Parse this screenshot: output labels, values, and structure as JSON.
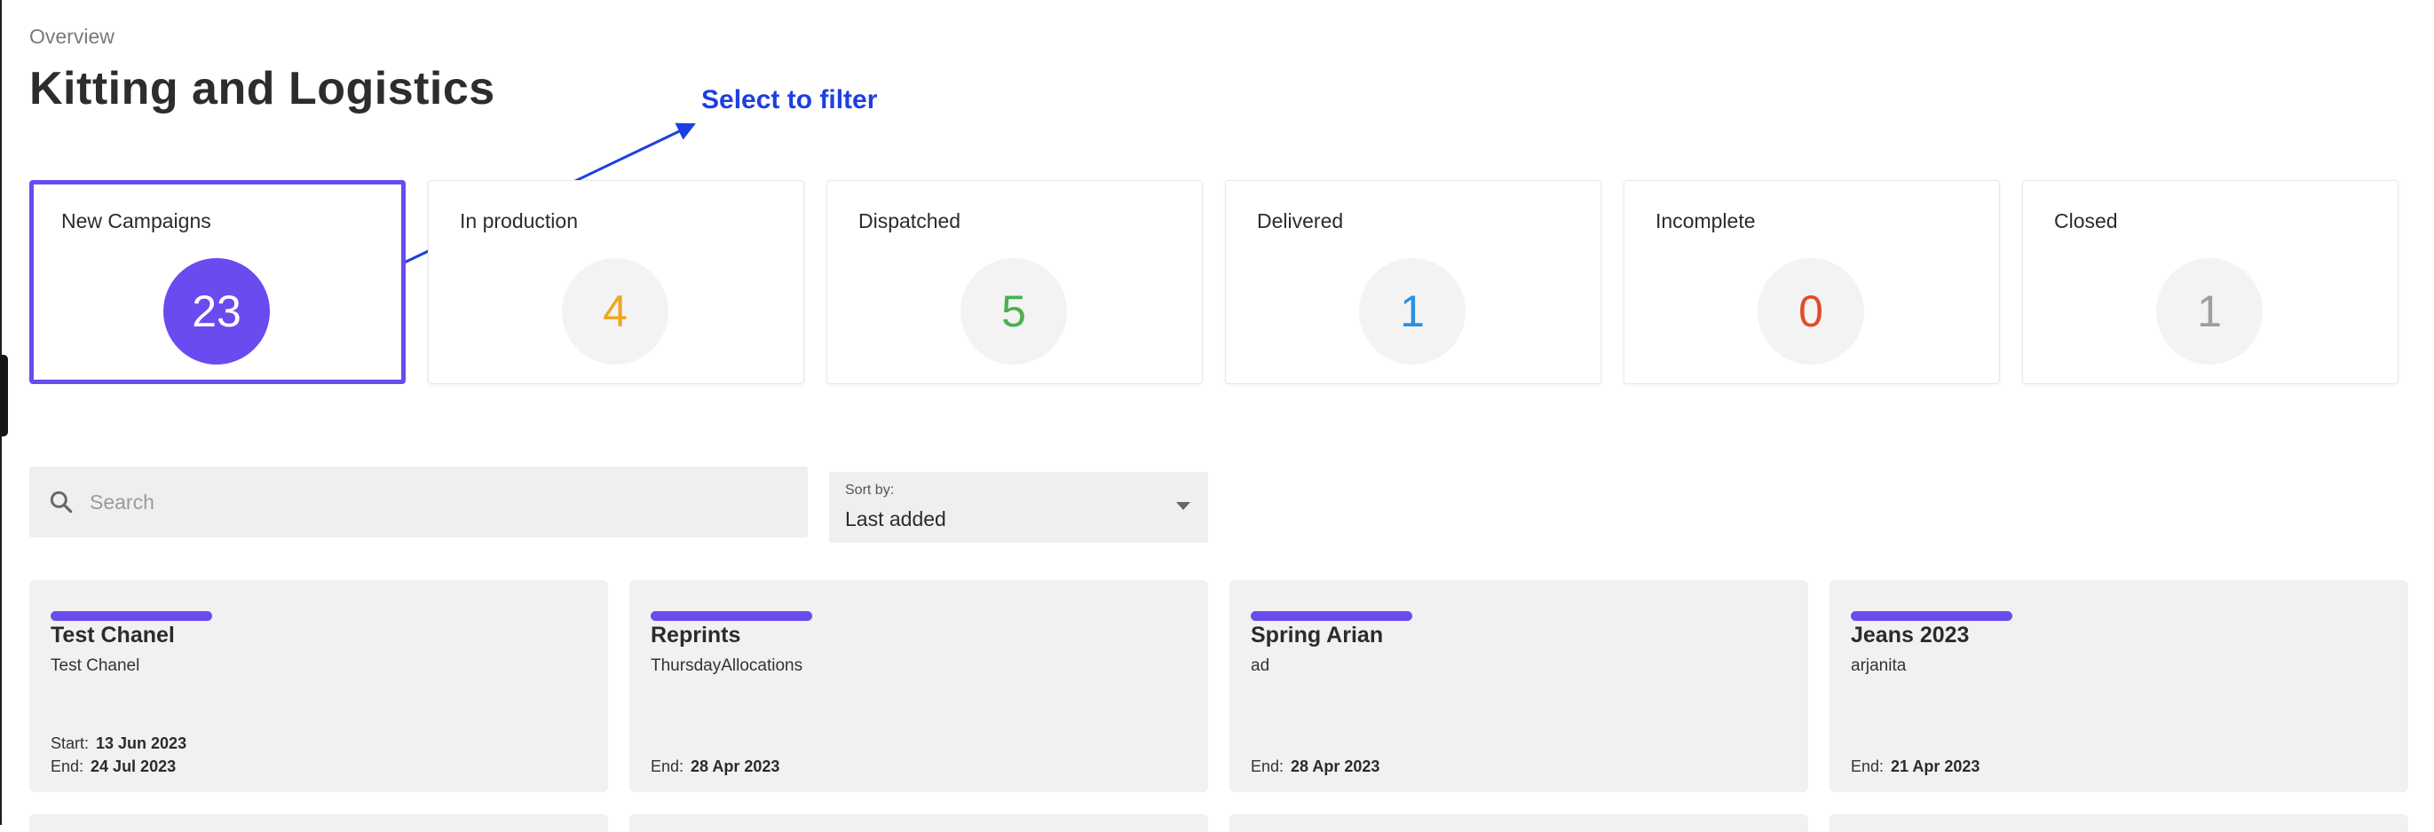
{
  "breadcrumb": "Overview",
  "page_title": "Kitting and Logistics",
  "annotation": {
    "text": "Select to filter",
    "color": "#1d3fe0"
  },
  "accent_color": "#6a4bf0",
  "stats": [
    {
      "label": "New Campaigns",
      "value": "23",
      "color": "#ffffff",
      "selected": true
    },
    {
      "label": "In production",
      "value": "4",
      "color": "#f0a623"
    },
    {
      "label": "Dispatched",
      "value": "5",
      "color": "#4caf50"
    },
    {
      "label": "Delivered",
      "value": "1",
      "color": "#2d8fe0"
    },
    {
      "label": "Incomplete",
      "value": "0",
      "color": "#e14b2a"
    },
    {
      "label": "Closed",
      "value": "1",
      "color": "#9e9e9e"
    }
  ],
  "search": {
    "placeholder": "Search",
    "icon": "search-icon"
  },
  "sort": {
    "label": "Sort by:",
    "value": "Last added",
    "icon": "caret-down-icon"
  },
  "campaigns": [
    {
      "title": "Test Chanel",
      "subtitle": "Test Chanel",
      "start_label": "Start:",
      "start": "13 Jun 2023",
      "end_label": "End:",
      "end": "24 Jul 2023"
    },
    {
      "title": "Reprints",
      "subtitle": "ThursdayAllocations",
      "end_label": "End:",
      "end": "28 Apr 2023"
    },
    {
      "title": "Spring Arian",
      "subtitle": "ad",
      "end_label": "End:",
      "end": "28 Apr 2023"
    },
    {
      "title": "Jeans 2023",
      "subtitle": "arjanita",
      "end_label": "End:",
      "end": "21 Apr 2023"
    }
  ]
}
